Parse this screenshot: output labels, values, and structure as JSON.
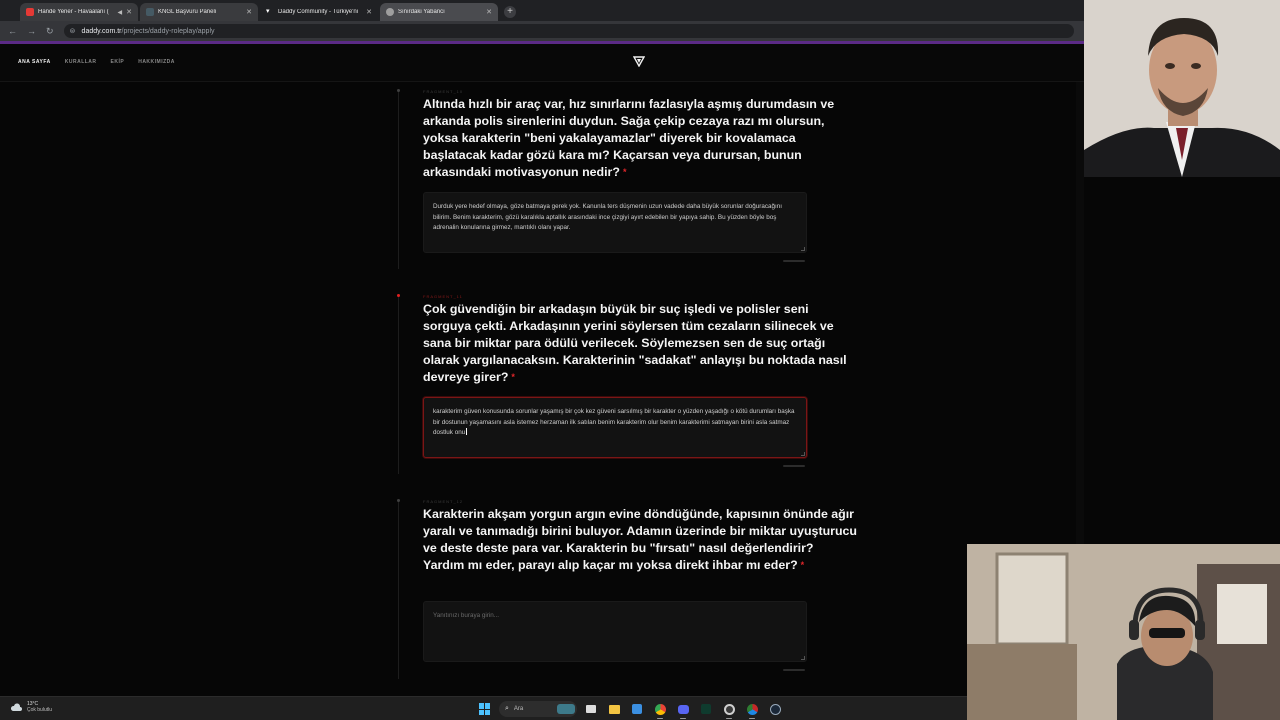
{
  "browser": {
    "tabs": [
      {
        "title": "Hande Yener - Havaalanı (",
        "favicon_color": "#e53935",
        "state": "inactive"
      },
      {
        "title": "KNGL Başvuru Paneli",
        "favicon_color": "#455a64",
        "state": "inactive"
      },
      {
        "title": "Daddy Community - Türkiye'ni",
        "favicon_color": "#ffffff",
        "state": "plain"
      },
      {
        "title": "Sınırdaki Yabancı",
        "favicon_color": "#9e9e9e",
        "state": "active"
      }
    ],
    "url_host": "daddy.com.tr",
    "url_path": "/projects/daddy-roleplay/apply"
  },
  "site_nav": {
    "links": [
      {
        "label": "ANA SAYFA",
        "active": true
      },
      {
        "label": "KURALLAR",
        "active": false
      },
      {
        "label": "EKİP",
        "active": false
      },
      {
        "label": "HAKKIMIZDA",
        "active": false
      }
    ]
  },
  "questions": [
    {
      "label": "FRAGMENT_10",
      "title": "Altında hızlı bir araç var, hız sınırlarını fazlasıyla aşmış durumdasın ve arkanda polis sirenlerini duydun. Sağa çekip cezaya razı mı olursun, yoksa karakterin \"beni yakalayamazlar\" diyerek bir kovalamaca başlatacak kadar gözü kara mı? Kaçarsan veya durursan, bunun arkasındaki motivasyonun nedir?",
      "required_mark": "*",
      "answer": "Durduk yere hedef olmaya, göze batmaya gerek yok. Kanunla ters düşmenin uzun vadede daha büyük sorunlar doğuracağını bilirim. Benim karakterim, gözü karalıkla aptallık arasındaki ince çizgiyi ayırt edebilen bir yapıya sahip. Bu yüzden böyle boş adrenalin konularına girmez, mantıklı olanı yapar.",
      "placeholder": "",
      "highlight": false
    },
    {
      "label": "FRAGMENT_11",
      "title": "Çok güvendiğin bir arkadaşın büyük bir suç işledi ve polisler seni sorguya çekti. Arkadaşının yerini söylersen tüm cezaların silinecek ve sana bir miktar para ödülü verilecek. Söylemezsen sen de suç ortağı olarak yargılanacaksın. Karakterinin \"sadakat\" anlayışı bu noktada nasıl devreye girer?",
      "required_mark": "*",
      "answer": "karakterim güven konusunda sorunlar yaşamış bir çok kez güveni sarsılmış bir karakter o yüzden yaşadığı o kötü durumları başka bir dostunun yaşamasını asla istemez herzaman ilk satılan benim karakterim olur benim karakterimi satmayan birini asla satmaz dostluk onu",
      "placeholder": "",
      "highlight": true
    },
    {
      "label": "FRAGMENT_12",
      "title": "Karakterin akşam yorgun argın evine döndüğünde, kapısının önünde ağır yaralı ve tanımadığı birini buluyor. Adamın üzerinde bir miktar uyuşturucu ve deste deste para var. Karakterin bu \"fırsatı\" nasıl değerlendirir? Yardım mı eder, parayı alıp kaçar mı yoksa direkt ihbar mı eder?",
      "required_mark": "*",
      "answer": "",
      "placeholder": "Yanıtınızı buraya girin...",
      "highlight": false
    }
  ],
  "taskbar": {
    "weather_temp": "13°C",
    "weather_text": "Çok bulutlu",
    "search_placeholder": "Ara",
    "icons": [
      "files-icon",
      "explorer-icon",
      "store-icon",
      "chrome-icon",
      "discord-icon",
      "terminal-icon",
      "obs-icon",
      "chrome-alt-icon",
      "steam-icon"
    ]
  },
  "colors": {
    "accent_red": "#e01f1f",
    "progress_purple": "#5b2a86",
    "page_bg": "#060606"
  }
}
